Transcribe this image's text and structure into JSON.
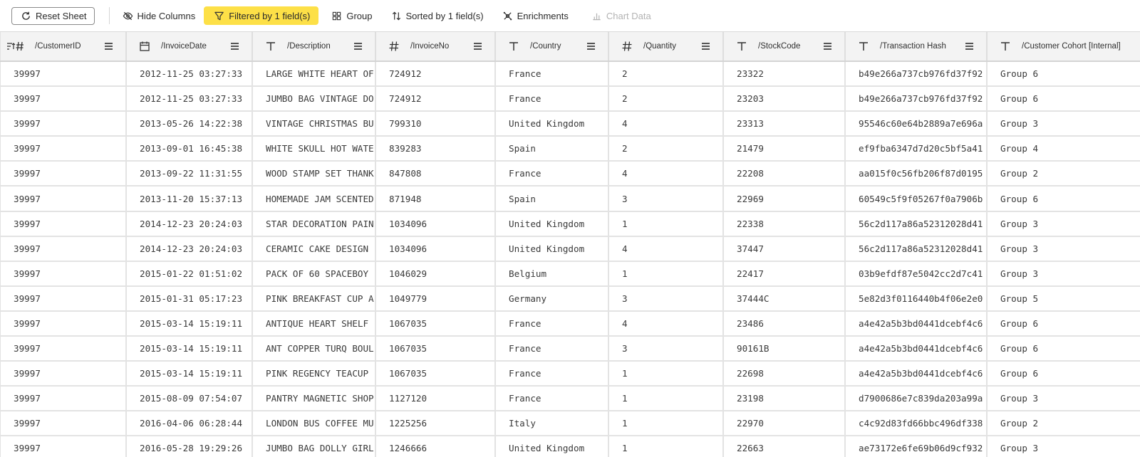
{
  "toolbar": {
    "reset_label": "Reset Sheet",
    "hide_columns_label": "Hide Columns",
    "filter_label": "Filtered by 1 field(s)",
    "group_label": "Group",
    "sort_label": "Sorted by 1 field(s)",
    "enrichments_label": "Enrichments",
    "chart_data_label": "Chart Data",
    "colors": {
      "filter_bg": "#fde047",
      "disabled_text": "#b3b3b3"
    }
  },
  "columns": [
    {
      "label": "/CustomerID",
      "type_icon": "number-sorted-icon"
    },
    {
      "label": "/InvoiceDate",
      "type_icon": "calendar-icon"
    },
    {
      "label": "/Description",
      "type_icon": "text-type-icon"
    },
    {
      "label": "/InvoiceNo",
      "type_icon": "number-type-icon"
    },
    {
      "label": "/Country",
      "type_icon": "text-type-icon"
    },
    {
      "label": "/Quantity",
      "type_icon": "number-type-icon"
    },
    {
      "label": "/StockCode",
      "type_icon": "text-type-icon"
    },
    {
      "label": "/Transaction Hash",
      "type_icon": "text-type-icon"
    },
    {
      "label": "/Customer Cohort [Internal]",
      "type_icon": "text-type-icon"
    }
  ],
  "rows": [
    [
      "39997",
      "2012-11-25 03:27:33",
      "LARGE WHITE HEART OF",
      "724912",
      "France",
      "2",
      "23322",
      "b49e266a737cb976fd37f92",
      "Group 6"
    ],
    [
      "39997",
      "2012-11-25 03:27:33",
      "JUMBO BAG VINTAGE DO",
      "724912",
      "France",
      "2",
      "23203",
      "b49e266a737cb976fd37f92",
      "Group 6"
    ],
    [
      "39997",
      "2013-05-26 14:22:38",
      "VINTAGE CHRISTMAS BU",
      "799310",
      "United Kingdom",
      "4",
      "23313",
      "95546c60e64b2889a7e696a",
      "Group 3"
    ],
    [
      "39997",
      "2013-09-01 16:45:38",
      "WHITE SKULL HOT WATE",
      "839283",
      "Spain",
      "2",
      "21479",
      "ef9fba6347d7d20c5bf5a41",
      "Group 4"
    ],
    [
      "39997",
      "2013-09-22 11:31:55",
      "WOOD STAMP SET THANK",
      "847808",
      "France",
      "4",
      "22208",
      "aa015f0c56fb206f87d0195",
      "Group 2"
    ],
    [
      "39997",
      "2013-11-20 15:37:13",
      "HOMEMADE JAM SCENTED",
      "871948",
      "Spain",
      "3",
      "22969",
      "60549c5f9f05267f0a7906b",
      "Group 6"
    ],
    [
      "39997",
      "2014-12-23 20:24:03",
      "STAR DECORATION PAIN",
      "1034096",
      "United Kingdom",
      "1",
      "22338",
      "56c2d117a86a52312028d41",
      "Group 3"
    ],
    [
      "39997",
      "2014-12-23 20:24:03",
      "CERAMIC CAKE DESIGN",
      "1034096",
      "United Kingdom",
      "4",
      "37447",
      "56c2d117a86a52312028d41",
      "Group 3"
    ],
    [
      "39997",
      "2015-01-22 01:51:02",
      "PACK OF 60 SPACEBOY",
      "1046029",
      "Belgium",
      "1",
      "22417",
      "03b9efdf87e5042cc2d7c41",
      "Group 3"
    ],
    [
      "39997",
      "2015-01-31 05:17:23",
      "PINK BREAKFAST CUP A",
      "1049779",
      "Germany",
      "3",
      "37444C",
      "5e82d3f0116440b4f06e2e0",
      "Group 5"
    ],
    [
      "39997",
      "2015-03-14 15:19:11",
      "ANTIQUE HEART SHELF",
      "1067035",
      "France",
      "4",
      "23486",
      "a4e42a5b3bd0441dcebf4c6",
      "Group 6"
    ],
    [
      "39997",
      "2015-03-14 15:19:11",
      "ANT COPPER TURQ BOUL",
      "1067035",
      "France",
      "3",
      "90161B",
      "a4e42a5b3bd0441dcebf4c6",
      "Group 6"
    ],
    [
      "39997",
      "2015-03-14 15:19:11",
      "PINK REGENCY TEACUP",
      "1067035",
      "France",
      "1",
      "22698",
      "a4e42a5b3bd0441dcebf4c6",
      "Group 6"
    ],
    [
      "39997",
      "2015-08-09 07:54:07",
      "PANTRY MAGNETIC SHOP",
      "1127120",
      "France",
      "1",
      "23198",
      "d7900686e7c839da203a99a",
      "Group 3"
    ],
    [
      "39997",
      "2016-04-06 06:28:44",
      "LONDON BUS COFFEE MU",
      "1225256",
      "Italy",
      "1",
      "22970",
      "c4c92d83fd66bbc496df338",
      "Group 2"
    ],
    [
      "39997",
      "2016-05-28 19:29:26",
      "JUMBO BAG DOLLY GIRL",
      "1246666",
      "United Kingdom",
      "1",
      "22663",
      "ae73172e6fe69b06d9cf932",
      "Group 3"
    ]
  ]
}
